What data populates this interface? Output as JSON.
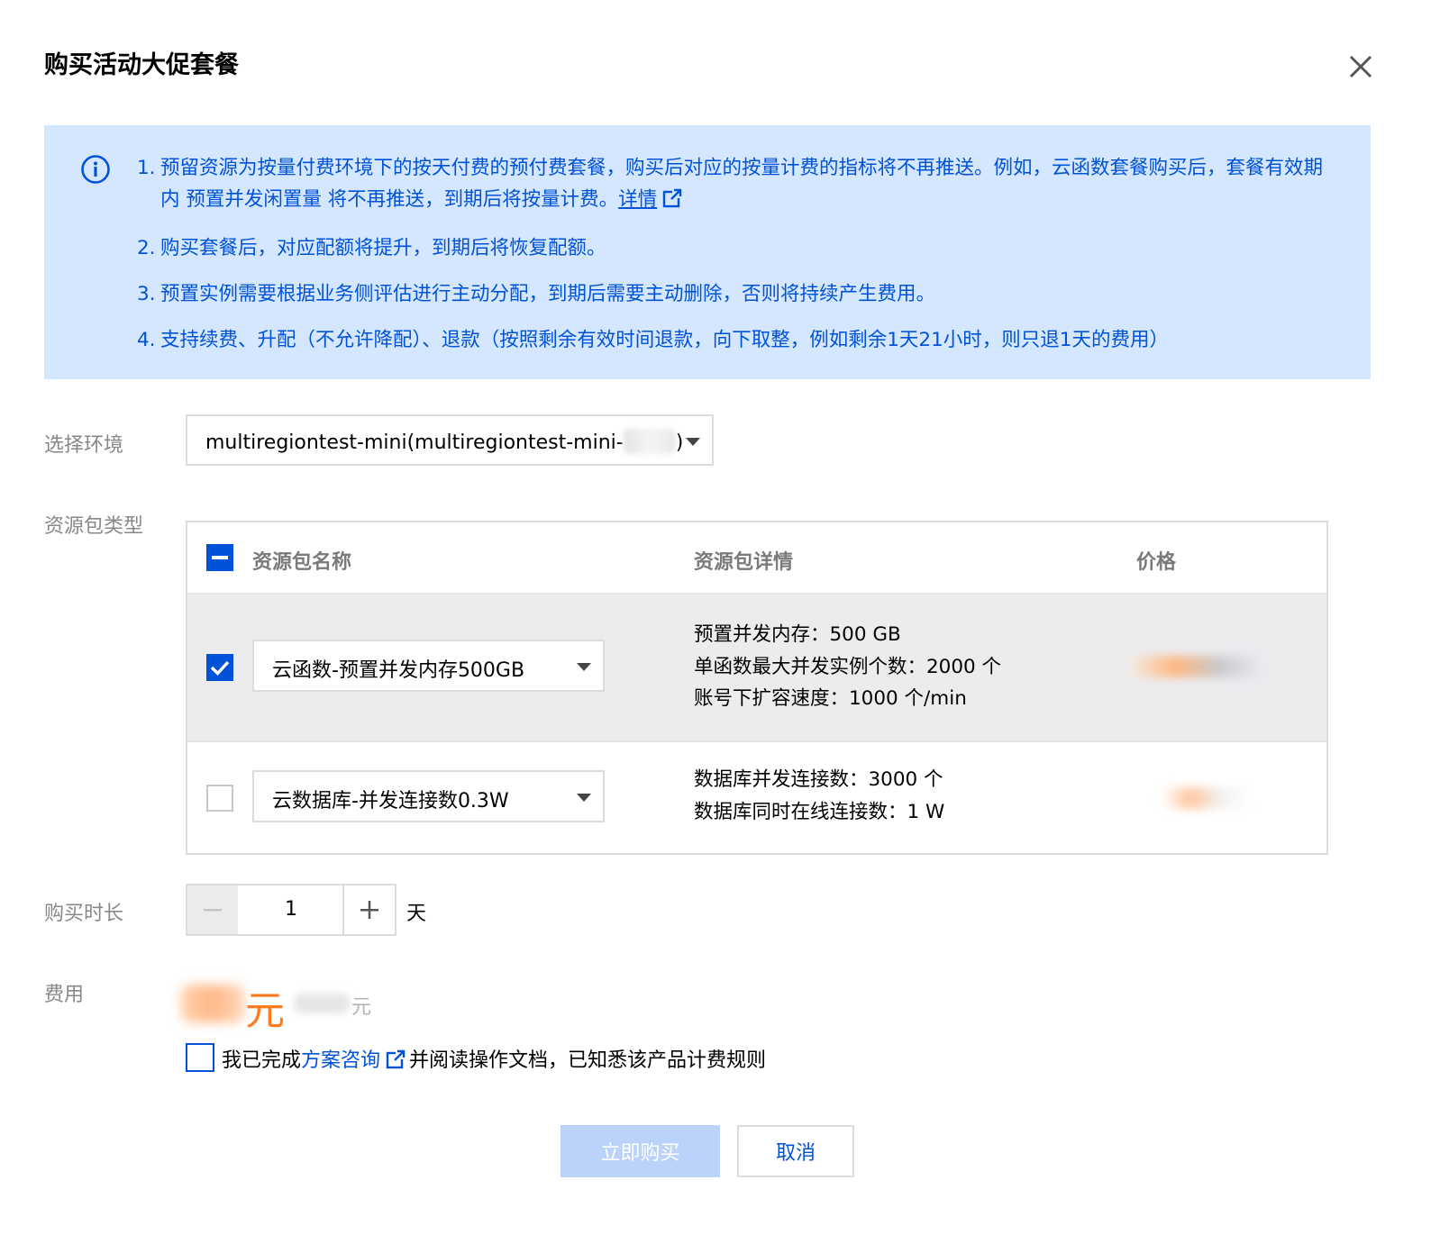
{
  "dialog": {
    "title": "购买活动大促套餐"
  },
  "notice": {
    "items": [
      {
        "num": "1.",
        "text": "预留资源为按量付费环境下的按天付费的预付费套餐，购买后对应的按量计费的指标将不再推送。例如，云函数套餐购买后，套餐有效期内 预置并发闲置量 将不再推送，到期后将按量计费。",
        "link": "详情"
      },
      {
        "num": "2.",
        "text": "购买套餐后，对应配额将提升，到期后将恢复配额。"
      },
      {
        "num": "3.",
        "text": "预置实例需要根据业务侧评估进行主动分配，到期后需要主动删除，否则将持续产生费用。"
      },
      {
        "num": "4.",
        "text": "支持续费、升配（不允许降配）、退款（按照剩余有效时间退款，向下取整，例如剩余1天21小时，则只退1天的费用）"
      }
    ]
  },
  "form": {
    "env_label": "选择环境",
    "env_value": "multiregiontest-mini(multiregiontest-mini-",
    "env_value_suffix": ")",
    "pkg_label": "资源包类型",
    "duration_label": "购买时长",
    "fee_label": "费用"
  },
  "table": {
    "headers": {
      "name": "资源包名称",
      "detail": "资源包详情",
      "price": "价格"
    },
    "rows": [
      {
        "checked": true,
        "select_value": "云函数-预置并发内存500GB",
        "details": [
          "预置并发内存：500 GB",
          "单函数最大并发实例个数：2000 个",
          "账号下扩容速度：1000 个/min"
        ]
      },
      {
        "checked": false,
        "select_value": "云数据库-并发连接数0.3W",
        "details": [
          "数据库并发连接数：3000 个",
          "数据库同时在线连接数：1 W"
        ]
      }
    ]
  },
  "duration": {
    "value": "1",
    "unit": "天"
  },
  "fee": {
    "unit": "元",
    "orig_unit": "元"
  },
  "agreement": {
    "prefix": "我已完成",
    "link": "方案咨询",
    "suffix": "并阅读操作文档，已知悉该产品计费规则"
  },
  "buttons": {
    "buy": "立即购买",
    "cancel": "取消"
  },
  "colors": {
    "primary": "#0052d9",
    "notice_bg": "#d5e7ff",
    "price_orange": "#ff7a1a",
    "buy_disabled": "#bbd3fb"
  }
}
